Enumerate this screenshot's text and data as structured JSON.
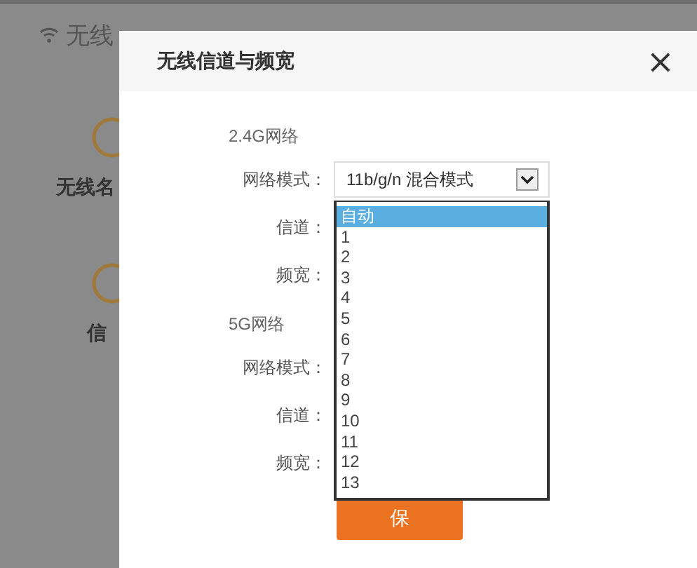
{
  "background_page": {
    "title": "无线",
    "items": [
      {
        "label": "无线名"
      },
      {
        "label": "信"
      }
    ]
  },
  "dialog": {
    "title": "无线信道与频宽",
    "close": "×",
    "sections": [
      {
        "heading": "2.4G网络",
        "fields": [
          {
            "label": "网络模式：",
            "kind": "select",
            "value": "11b/g/n 混合模式"
          },
          {
            "label": "信道：",
            "kind": "listbox",
            "options": [
              {
                "label": "自动",
                "selected": true
              },
              {
                "label": "1",
                "selected": false
              },
              {
                "label": "2",
                "selected": false
              },
              {
                "label": "3",
                "selected": false
              },
              {
                "label": "4",
                "selected": false
              },
              {
                "label": "5",
                "selected": false
              },
              {
                "label": "6",
                "selected": false
              },
              {
                "label": "7",
                "selected": false
              },
              {
                "label": "8",
                "selected": false
              },
              {
                "label": "9",
                "selected": false
              },
              {
                "label": "10",
                "selected": false
              },
              {
                "label": "11",
                "selected": false
              },
              {
                "label": "12",
                "selected": false
              },
              {
                "label": "13",
                "selected": false
              }
            ]
          },
          {
            "label": "频宽：",
            "kind": "covered"
          }
        ]
      },
      {
        "heading": "5G网络",
        "fields": [
          {
            "label": "网络模式：",
            "kind": "covered"
          },
          {
            "label": "信道：",
            "kind": "covered"
          },
          {
            "label": "频宽：",
            "kind": "covered"
          }
        ]
      }
    ],
    "save_button": "保"
  }
}
